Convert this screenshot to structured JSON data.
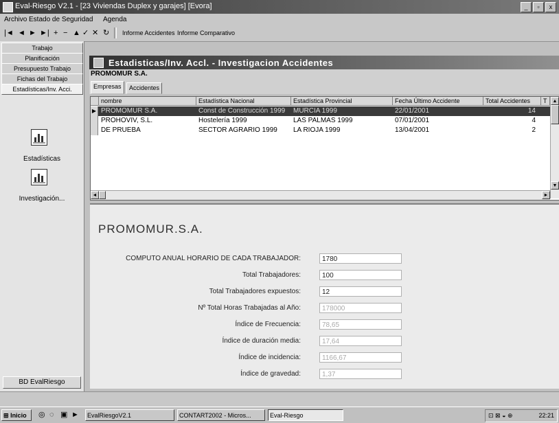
{
  "window": {
    "title": "Eval-Riesgo V2.1 - [23 Viviendas Duplex y garajes] [Evora]"
  },
  "menu": {
    "archivo": "Archivo",
    "estado": "Estado de Seguridad",
    "agenda": "Agenda"
  },
  "toolbar": {
    "informe_accidentes": "Informe Accidentes",
    "informe_comparativo": "Informe Comparativo"
  },
  "sidebar": {
    "items": [
      "Trabajo",
      "Planificación",
      "Presupuesto Trabajo",
      "Fichas del Trabajo",
      "Estadísticas/Inv. Acci."
    ],
    "icons": [
      {
        "icon": "chart-icon",
        "label": "Estadísticas"
      },
      {
        "icon": "chart-icon",
        "label": "Investigación..."
      }
    ],
    "bd_button": "BD EvalRiesgo"
  },
  "child_window": {
    "title": "Estadisticas/Inv. Accl. - Investigacion Accidentes",
    "subheader": "PROMOMUR S.A."
  },
  "tabs": [
    "Empresas",
    "Accidentes"
  ],
  "grid": {
    "headers": [
      "nombre",
      "Estadística Nacional",
      "Estadística Provincial",
      "Fecha Último Accidente",
      "Total Accidentes",
      "T"
    ],
    "rows": [
      [
        "PROMOMUR S.A.",
        "Const de Construcción 1999",
        "MURCIA 1999",
        "22/01/2001",
        "14",
        ""
      ],
      [
        "PROHOVIV, S.L.",
        "Hostelería 1999",
        "LAS PALMAS 1999",
        "07/01/2001",
        "4",
        ""
      ],
      [
        "DE PRUEBA",
        "SECTOR AGRARIO 1999",
        "LA RIOJA 1999",
        "13/04/2001",
        "2",
        ""
      ]
    ]
  },
  "detail": {
    "company": "PROMOMUR.S.A.",
    "fields": [
      {
        "label": "COMPUTO ANUAL HORARIO DE CADA TRABAJADOR:",
        "value": "1780"
      },
      {
        "label": "Total Trabajadores:",
        "value": "100"
      },
      {
        "label": "Total Trabajadores expuestos:",
        "value": "12"
      },
      {
        "label": "Nº Total Horas Trabajadas al Año:",
        "value": "178000"
      },
      {
        "label": "Índice de Frecuencia:",
        "value": "78,65"
      },
      {
        "label": "Índice de duración media:",
        "value": "17,64"
      },
      {
        "label": "Índice de incidencia:",
        "value": "1166,67"
      },
      {
        "label": "Índice de gravedad:",
        "value": "1,37"
      }
    ]
  },
  "taskbar": {
    "start": "Inicio",
    "buttons": [
      "EvalRiesgoV2.1",
      "CONTART2002 - Micros...",
      "Eval-Riesgo"
    ],
    "clock": "22:21"
  }
}
